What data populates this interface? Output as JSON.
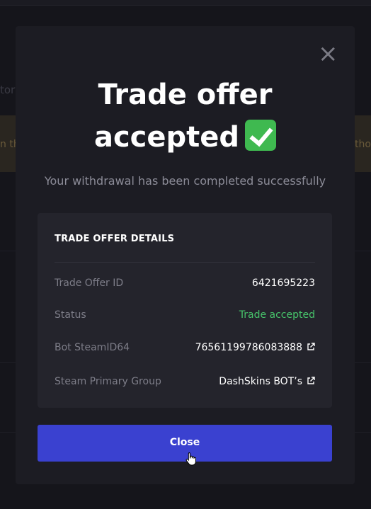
{
  "background": {
    "left_text": "tory",
    "band_left_text": "n th",
    "band_right_text": "itho"
  },
  "modal": {
    "title_line1": "Trade offer",
    "title_line2": "accepted",
    "title_emoji_icon": "check-mark-icon",
    "subtitle": "Your withdrawal has been completed successfully",
    "close_icon": "close-icon",
    "details": {
      "heading": "TRADE OFFER DETAILS",
      "rows": [
        {
          "label": "Trade Offer ID",
          "value": "6421695223"
        },
        {
          "label": "Status",
          "value": "Trade accepted",
          "status_color": "#47c46b"
        },
        {
          "label": "Bot SteamID64",
          "value": "76561199786083888",
          "icon": "external-link-icon"
        },
        {
          "label": "Steam Primary Group",
          "value": "DashSkins BOT’s",
          "icon": "external-link-icon"
        }
      ]
    },
    "close_button_label": "Close"
  },
  "colors": {
    "accent": "#3a41d0",
    "success": "#47c46b"
  }
}
